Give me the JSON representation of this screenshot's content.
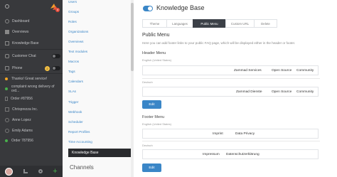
{
  "sidebar": {
    "items": [
      {
        "label": "Dashboard"
      },
      {
        "label": "Overviews"
      },
      {
        "label": "Knowledge Base"
      },
      {
        "label": "Customer Chat"
      },
      {
        "label": "Phone",
        "badge": "2"
      },
      {
        "label": "Thanks! Great service!"
      },
      {
        "label": "complaint wrong delivery of ord..."
      },
      {
        "label": "Order #87956"
      },
      {
        "label": "Chrisprezza Inc."
      },
      {
        "label": "Anne Lopez"
      },
      {
        "label": "Emily Adams"
      },
      {
        "label": "Order 787956"
      }
    ],
    "logo_badge": "4"
  },
  "settings_nav": {
    "items": [
      "Users",
      "Groups",
      "Roles",
      "Organizations",
      "Overviews",
      "Text modules",
      "Macros",
      "Tags",
      "Calendars",
      "SLAs",
      "Trigger",
      "Webhook",
      "Scheduler",
      "Report Profiles",
      "Time Accounting"
    ],
    "active": "Knowledge Base",
    "section": "Channels"
  },
  "main": {
    "title": "Knowledge Base",
    "tabs": [
      "Theme",
      "Languages",
      "Public Menu",
      "Custom URL",
      "Delete"
    ],
    "public_menu_title": "Public Menu",
    "public_menu_desc": "Here you can add footer links to your public FAQ page, which will be displayed either in the header or footer.",
    "header_menu": {
      "title": "Header Menu",
      "langs": [
        {
          "label": "English (United States)",
          "links": [
            "Zammad Services",
            "Open Source",
            "Community"
          ]
        },
        {
          "label": "Deutsch",
          "links": [
            "Zammad Dienste",
            "Open Source",
            "Community"
          ]
        }
      ],
      "edit": "Edit"
    },
    "footer_menu": {
      "title": "Footer Menu",
      "langs": [
        {
          "label": "English (United States)",
          "links": [
            "Imprint",
            "Data Privacy"
          ]
        },
        {
          "label": "Deutsch",
          "links": [
            "Impressum",
            "Datenschutzerklärung"
          ]
        }
      ],
      "edit": "Edit"
    }
  },
  "colors": {
    "accent": "#3a86c7",
    "sidebar": "#38393c",
    "active_tab": "#3b4047"
  }
}
